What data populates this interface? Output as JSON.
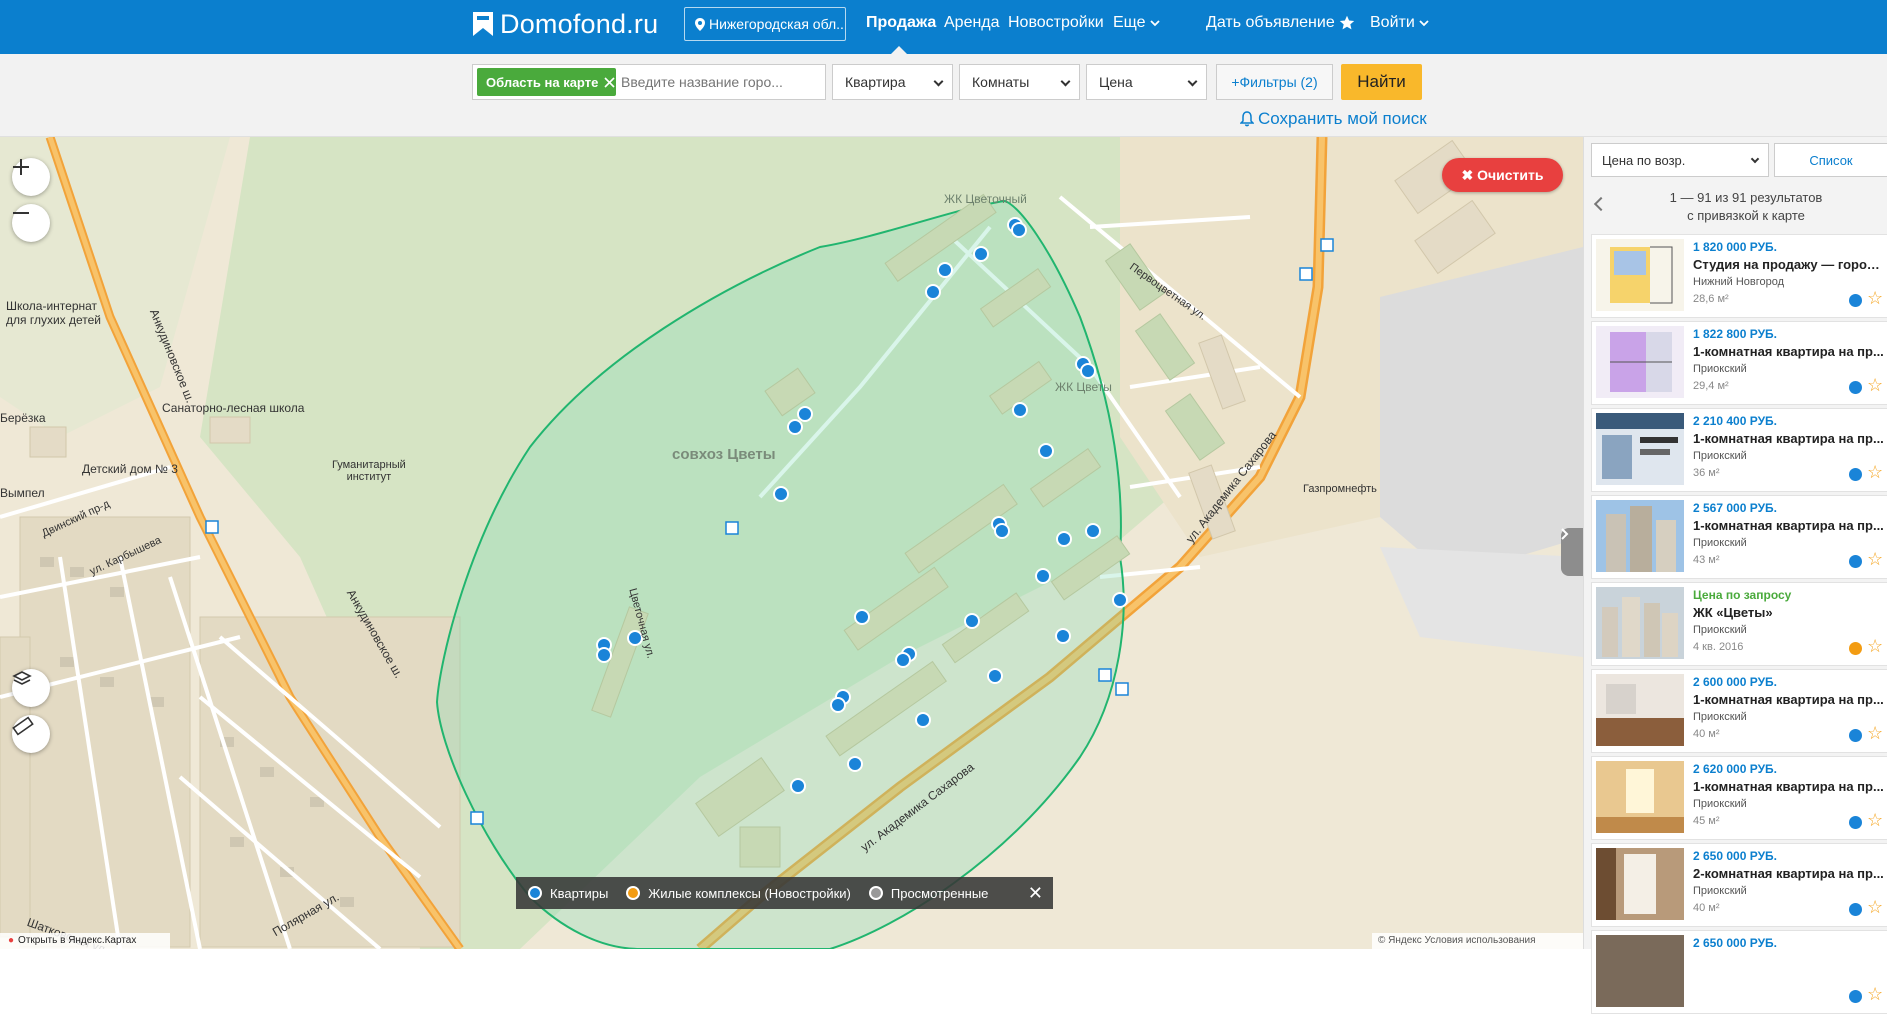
{
  "header": {
    "logo_text": "Domofond.ru",
    "region": "Нижегородская обл..",
    "nav": {
      "sale": "Продажа",
      "rent": "Аренда",
      "new_buildings": "Новостройки",
      "more": "Еще",
      "post_ad": "Дать объявление",
      "login": "Войти"
    },
    "colors": {
      "bar": "#0b7fce",
      "accent": "#f9b82b"
    }
  },
  "search": {
    "area_chip": "Область на карте",
    "input_placeholder": "Введите название горо...",
    "type": "Квартира",
    "rooms": "Комнаты",
    "price": "Цена",
    "filters": "+Фильтры (2)",
    "find": "Найти",
    "save_search": "Сохранить мой поиск"
  },
  "map": {
    "clear_button": "✖ Очистить",
    "footer_left": "Открыть в Яндекс.Картах",
    "footer_right": "© Яндекс  Условия использования",
    "legend": {
      "apartments": "Квартиры",
      "complexes": "Жилые комплексы (Новостройки)",
      "viewed": "Просмотренные",
      "colors": {
        "apartments": "#1a84d8",
        "complexes": "#f39c12",
        "viewed": "#999999"
      }
    },
    "labels": {
      "school": "Школа-интернат\nдля глухих детей",
      "school_l1": "Школа-интернат",
      "school_l2": "для глухих детей",
      "sanatorium": "Санаторно-лесная школа",
      "orphanage": "Детский дом № 3",
      "gum_l1": "Гуманитарный",
      "gum_l2": "институт",
      "berezka": "Берёзка",
      "vympel": "Вымпел",
      "sovkhoz": "совхоз Цветы",
      "zhk_tsvety_top": "ЖК Цветочный",
      "zhk_tsvety": "ЖК Цветы",
      "pervotsvet": "Первоцветная ул.",
      "sakharova1": "ул. Академика Сахарова",
      "sakharova2": "ул. Академика Сахарова",
      "gazprom": "Газпромнефть",
      "ankudinov1": "Анкудиновское ш.",
      "ankudinov2": "Анкудиновское ш.",
      "tsvetochnaya": "Цветочная ул.",
      "dvinsky": "Двинский пр-д",
      "karbysheva": "ул. Карбышева",
      "polyarnaya": "Полярная ул.",
      "shatkovskaya": "Шатковская ул."
    }
  },
  "results": {
    "sort": "Цена по возр.",
    "list_button": "Список",
    "count_line1": "1 — 91 из 91 результатов",
    "count_line2": "с привязкой к карте",
    "items": [
      {
        "price": "1 820 000 РУБ.",
        "title": "Студия на продажу — город ...",
        "district": "Нижний Новгород",
        "area": "28,6 м²",
        "marker": "#1a84d8"
      },
      {
        "price": "1 822 800 РУБ.",
        "title": "1-комнатная квартира на пр...",
        "district": "Приокский",
        "area": "29,4 м²",
        "marker": "#1a84d8"
      },
      {
        "price": "2 210 400 РУБ.",
        "title": "1-комнатная квартира на пр...",
        "district": "Приокский",
        "area": "36 м²",
        "marker": "#1a84d8"
      },
      {
        "price": "2 567 000 РУБ.",
        "title": "1-комнатная квартира на пр...",
        "district": "Приокский",
        "area": "43 м²",
        "marker": "#1a84d8"
      },
      {
        "price": "Цена по запросу",
        "title": "ЖК «Цветы»",
        "district": "Приокский",
        "area": "4 кв. 2016",
        "marker": "#f39c12"
      },
      {
        "price": "2 600 000 РУБ.",
        "title": "1-комнатная квартира на пр...",
        "district": "Приокский",
        "area": "40 м²",
        "marker": "#1a84d8"
      },
      {
        "price": "2 620 000 РУБ.",
        "title": "1-комнатная квартира на пр...",
        "district": "Приокский",
        "area": "45 м²",
        "marker": "#1a84d8"
      },
      {
        "price": "2 650 000 РУБ.",
        "title": "2-комнатная квартира на пр...",
        "district": "Приокский",
        "area": "40 м²",
        "marker": "#1a84d8"
      },
      {
        "price": "2 650 000 РУБ.",
        "title": "",
        "district": "",
        "area": "",
        "marker": "#1a84d8"
      }
    ]
  }
}
